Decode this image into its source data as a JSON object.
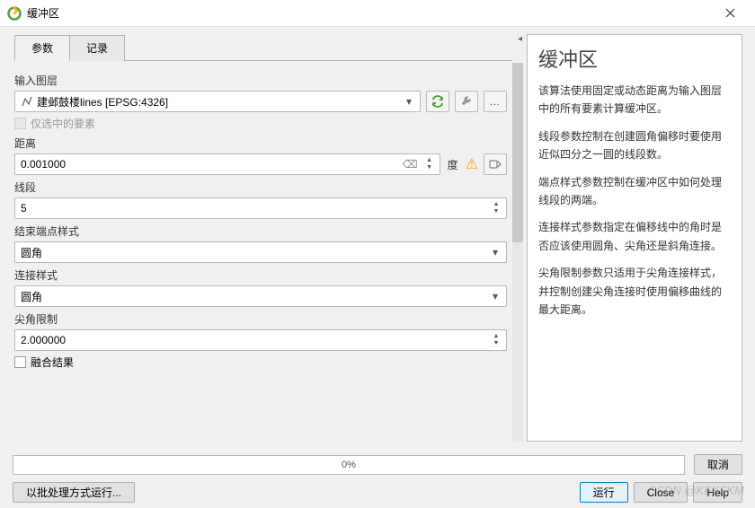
{
  "window": {
    "title": "缓冲区"
  },
  "tabs": {
    "params": "参数",
    "log": "记录"
  },
  "fields": {
    "input_layer_label": "输入图层",
    "input_layer_value": "建邺鼓楼lines [EPSG:4326]",
    "selected_only_label": "仅选中的要素",
    "distance_label": "距离",
    "distance_value": "0.001000",
    "distance_unit": "度",
    "segments_label": "线段",
    "segments_value": "5",
    "endcap_label": "结束端点样式",
    "endcap_value": "圆角",
    "join_label": "连接样式",
    "join_value": "圆角",
    "miter_label": "尖角限制",
    "miter_value": "2.000000",
    "dissolve_label": "融合结果"
  },
  "help": {
    "title": "缓冲区",
    "p1": "该算法使用固定或动态距离为输入图层中的所有要素计算缓冲区。",
    "p2": "线段参数控制在创建圆角偏移时要使用近似四分之一圆的线段数。",
    "p3": "端点样式参数控制在缓冲区中如何处理线段的两端。",
    "p4": "连接样式参数指定在偏移线中的角时是否应该使用圆角、尖角还是斜角连接。",
    "p5": "尖角限制参数只适用于尖角连接样式，并控制创建尖角连接时使用偏移曲线的最大距离。"
  },
  "progress": {
    "text": "0%"
  },
  "buttons": {
    "cancel": "取消",
    "batch": "以批处理方式运行...",
    "run": "运行",
    "close": "Close",
    "help": "Help"
  },
  "watermark": "CSDN @KEKFKM"
}
